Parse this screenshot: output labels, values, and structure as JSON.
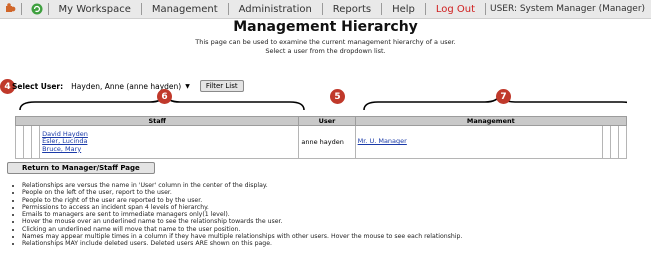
{
  "toolbar": {
    "nav": [
      "My Workspace",
      "Management",
      "Administration",
      "Reports",
      "Help",
      "Log Out"
    ],
    "user_label": "USER: System Manager (Manager)"
  },
  "page": {
    "title": "Management Hierarchy",
    "desc_line1": "This page can be used to examine the current management hierarchy of a user.",
    "desc_line2": "Select a user from the dropdown list."
  },
  "filter": {
    "label": "Select User:",
    "selected_user": "Hayden, Anne (anne hayden)",
    "button": "Filter List"
  },
  "badges": {
    "b4": "4",
    "b5": "5",
    "b6": "6",
    "b7": "7"
  },
  "table": {
    "headers": {
      "staff": "Staff",
      "user": "User",
      "management": "Management"
    },
    "staff": [
      "David Hayden",
      "Esler, Lucinda",
      "Bruce, Mary"
    ],
    "user": "anne hayden",
    "management": [
      "Mr. U. Manager"
    ]
  },
  "return_button": "Return to Manager/Staff Page",
  "notes": [
    "Relationships are versus the name in 'User' column in the center of the display.",
    "People on the left of the user, report to the user.",
    "People to the right of the user are reported to by the user.",
    "Permissions to access an incident span 4 levels of hierarchy.",
    "Emails to managers are sent to immediate managers only(1 level).",
    "Hover the mouse over an underlined name to see the relationship towards the user.",
    "Clicking an underlined name will move that name to the user position.",
    "Names may appear multiple times in a column if they have multiple relationships with other users. Hover the mouse to see each relationship.",
    "Relationships MAY include deleted users. Deleted users ARE shown on this page."
  ],
  "colors": {
    "badge": "#c0392b",
    "link": "#1a3aa8",
    "logout": "#d02020",
    "header_bg": "#c9c9c9"
  }
}
